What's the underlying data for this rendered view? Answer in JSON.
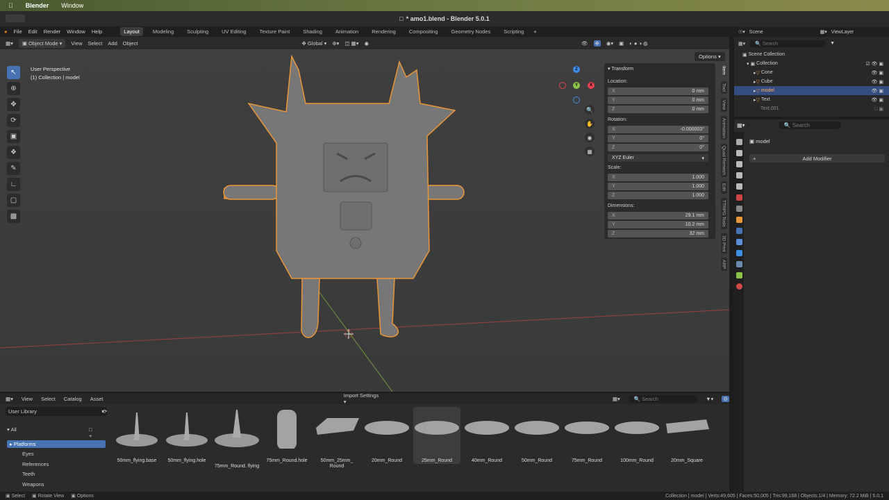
{
  "mac": {
    "app": "Blender",
    "menu": "Window"
  },
  "window_title": "* amo1.blend - Blender 5.0.1",
  "menus": [
    "File",
    "Edit",
    "Render",
    "Window",
    "Help"
  ],
  "workspaces": [
    "Layout",
    "Modeling",
    "Sculpting",
    "UV Editing",
    "Texture Paint",
    "Shading",
    "Animation",
    "Rendering",
    "Compositing",
    "Geometry Nodes",
    "Scripting"
  ],
  "header": {
    "mode": "Object Mode",
    "view": "View",
    "select": "Select",
    "add": "Add",
    "object": "Object",
    "orientation": "Global",
    "options": "Options"
  },
  "viewport": {
    "perspective": "User Perspective",
    "collection": "(1) Collection | model"
  },
  "npanel": {
    "title": "Transform",
    "location_label": "Location:",
    "location": [
      {
        "ax": "X",
        "val": "0 mm"
      },
      {
        "ax": "Y",
        "val": "0 mm"
      },
      {
        "ax": "Z",
        "val": "0 mm"
      }
    ],
    "rotation_label": "Rotation:",
    "rotation": [
      {
        "ax": "X",
        "val": "-0.000003°"
      },
      {
        "ax": "Y",
        "val": "0°"
      },
      {
        "ax": "Z",
        "val": "0°"
      }
    ],
    "euler": "XYZ Euler",
    "scale_label": "Scale:",
    "scale": [
      {
        "ax": "X",
        "val": "1.000"
      },
      {
        "ax": "Y",
        "val": "1.000"
      },
      {
        "ax": "Z",
        "val": "1.000"
      }
    ],
    "dimensions_label": "Dimensions:",
    "dimensions": [
      {
        "ax": "X",
        "val": "29.1 mm"
      },
      {
        "ax": "Y",
        "val": "10.2 mm"
      },
      {
        "ax": "Z",
        "val": "32 mm"
      }
    ]
  },
  "vtabs": [
    "Item",
    "Tool",
    "View",
    "Animation",
    "Quad Remesh",
    "Edit",
    "TTRPG Tools",
    "3D Print",
    "ARP"
  ],
  "outliner": {
    "scene": "Scene",
    "viewlayer": "ViewLayer",
    "search": "Search",
    "scene_collection": "Scene Collection",
    "items": [
      {
        "label": "Collection"
      },
      {
        "label": "Cone"
      },
      {
        "label": "Cube"
      },
      {
        "label": "model"
      },
      {
        "label": "Text"
      },
      {
        "label": "Text.001"
      }
    ]
  },
  "properties": {
    "search": "Search",
    "object_name": "model",
    "add_modifier": "Add Modifier"
  },
  "browser": {
    "menus": [
      "View",
      "Select",
      "Catalog",
      "Asset"
    ],
    "import_settings": "Import Settings",
    "search": "Search",
    "library": "User Library",
    "catalogs": [
      "All",
      "Platforms",
      "Eyes",
      "References",
      "Teeth",
      "Weapons"
    ],
    "assets": [
      "50mm_flying.base",
      "50mm_flying.hole",
      "75mm_Round. flying",
      "75mm_Round.hole",
      "50mm_25mm_ Round",
      "20mm_Round",
      "25mm_Round",
      "40mm_Round",
      "50mm_Round",
      "75mm_Round",
      "100mm_Round",
      "20mm_Square"
    ]
  },
  "status": {
    "left": [
      "Select",
      "Rotate View",
      "Options"
    ],
    "right": "Collection | model | Verts:49,605 | Faces:50,005 | Tris:99,168 | Objects:1/4 | Memory: 72.2 MiB | 5.0.1"
  },
  "colors": {
    "accent": "#4772b3",
    "selection_outline": "#e8963a",
    "axis_x": "#e5424f",
    "axis_y": "#8bc34a",
    "axis_z": "#3f8ee6"
  }
}
